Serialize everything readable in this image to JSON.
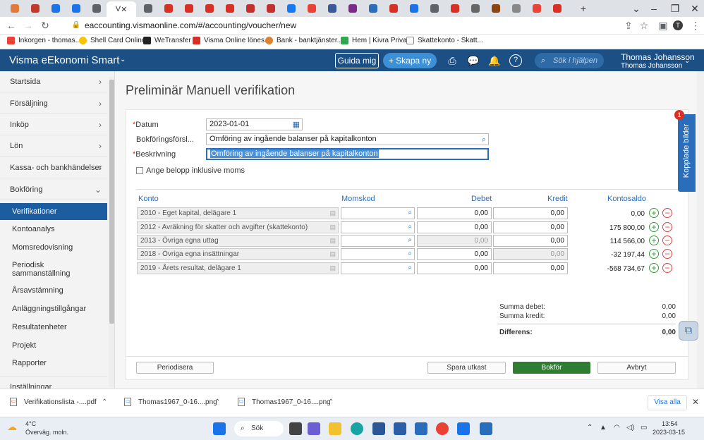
{
  "browser": {
    "active_tab_label": "V",
    "url": "eaccounting.vismaonline.com/#/accounting/voucher/new",
    "bookmarks": [
      "Inkorgen - thomas...",
      "Shell Card Online",
      "WeTransfer",
      "Visma Online lönes...",
      "Bank - banktjänster...",
      "Hem | Kivra Privat",
      "Skattekonto - Skatt..."
    ],
    "tab_colors": [
      "#e07b39",
      "#c0392b",
      "#1a73e8",
      "#1a73e8",
      "#5f6368",
      "#5f6368",
      "#d93025",
      "#d93025",
      "#d93025",
      "#d93025",
      "#c4302b",
      "#c4302b",
      "#1877f2",
      "#ea4335",
      "#3b5998",
      "#7b2a8a",
      "#2a6ebb",
      "#d93025",
      "#1a73e8",
      "#5f6368",
      "#d93025",
      "#666",
      "#8b4513",
      "#888",
      "#ea4335",
      "#d93025"
    ]
  },
  "header": {
    "brand": "Visma eEkonomi Smart",
    "guide_label": "Guida mig",
    "create_label": "+ Skapa ny",
    "help_placeholder": "Sök i hjälpen",
    "user_name": "Thomas Johansson",
    "company_name": "Thomas Johansson"
  },
  "sidebar": {
    "items": [
      "Startsida",
      "Försäljning",
      "Inköp",
      "Lön",
      "Kassa- och bankhändelser",
      "Bokföring"
    ],
    "subitems": [
      "Verifikationer",
      "Kontoanalys",
      "Momsredovisning",
      "Periodisk sammanställning",
      "Årsavstämning",
      "Anläggningstillgångar",
      "Resultatenheter",
      "Projekt",
      "Rapporter"
    ],
    "bottom_item": "Inställningar"
  },
  "page": {
    "title": "Preliminär Manuell verifikation",
    "date_label": "Datum",
    "date_value": "2023-01-01",
    "suggestion_label": "Bokföringsförsl...",
    "suggestion_value": "Omföring av ingående balanser på kapitalkonton",
    "description_label": "Beskrivning",
    "description_value": "Omföring av ingående balanser på kapitalkonton",
    "vat_checkbox_label": "Ange belopp inklusive moms",
    "columns": {
      "konto": "Konto",
      "momskod": "Momskod",
      "debet": "Debet",
      "kredit": "Kredit",
      "saldo": "Kontosaldo"
    },
    "rows": [
      {
        "account": "2010 - Eget kapital, delägare 1",
        "debet": "0,00",
        "kredit": "0,00",
        "saldo": "0,00",
        "disabled": false
      },
      {
        "account": "2012 - Avräkning för skatter och avgifter (skattekonto)",
        "debet": "0,00",
        "kredit": "0,00",
        "saldo": "175 800,00",
        "disabled": false
      },
      {
        "account": "2013 - Övriga egna uttag",
        "debet": "0,00",
        "kredit": "0,00",
        "saldo": "114 566,00",
        "disabled": true
      },
      {
        "account": "2018 - Övriga egna insättningar",
        "debet": "0,00",
        "kredit": "0,00",
        "saldo": "-32 197,44",
        "disabled": true
      },
      {
        "account": "2019 - Årets resultat, delägare 1",
        "debet": "0,00",
        "kredit": "0,00",
        "saldo": "-568 734,67",
        "disabled": false
      }
    ],
    "summa_debet_label": "Summa debet:",
    "summa_debet_value": "0,00",
    "summa_kredit_label": "Summa kredit:",
    "summa_kredit_value": "0,00",
    "differens_label": "Differens:",
    "differens_value": "0,00",
    "periodisera_label": "Periodisera",
    "spara_label": "Spara utkast",
    "bokfor_label": "Bokför",
    "avbryt_label": "Avbryt",
    "sidetab_label": "Kopplade bilder",
    "sidetab_badge": "1"
  },
  "downloads": {
    "items": [
      "Verifikationslista -....pdf",
      "Thomas1967_0-16....png",
      "Thomas1967_0-16....png"
    ],
    "show_all": "Visa alla"
  },
  "taskbar": {
    "temperature": "4°C",
    "condition": "Överväg. moln.",
    "search_label": "Sök",
    "time": "13:54",
    "date": "2023-03-15"
  }
}
